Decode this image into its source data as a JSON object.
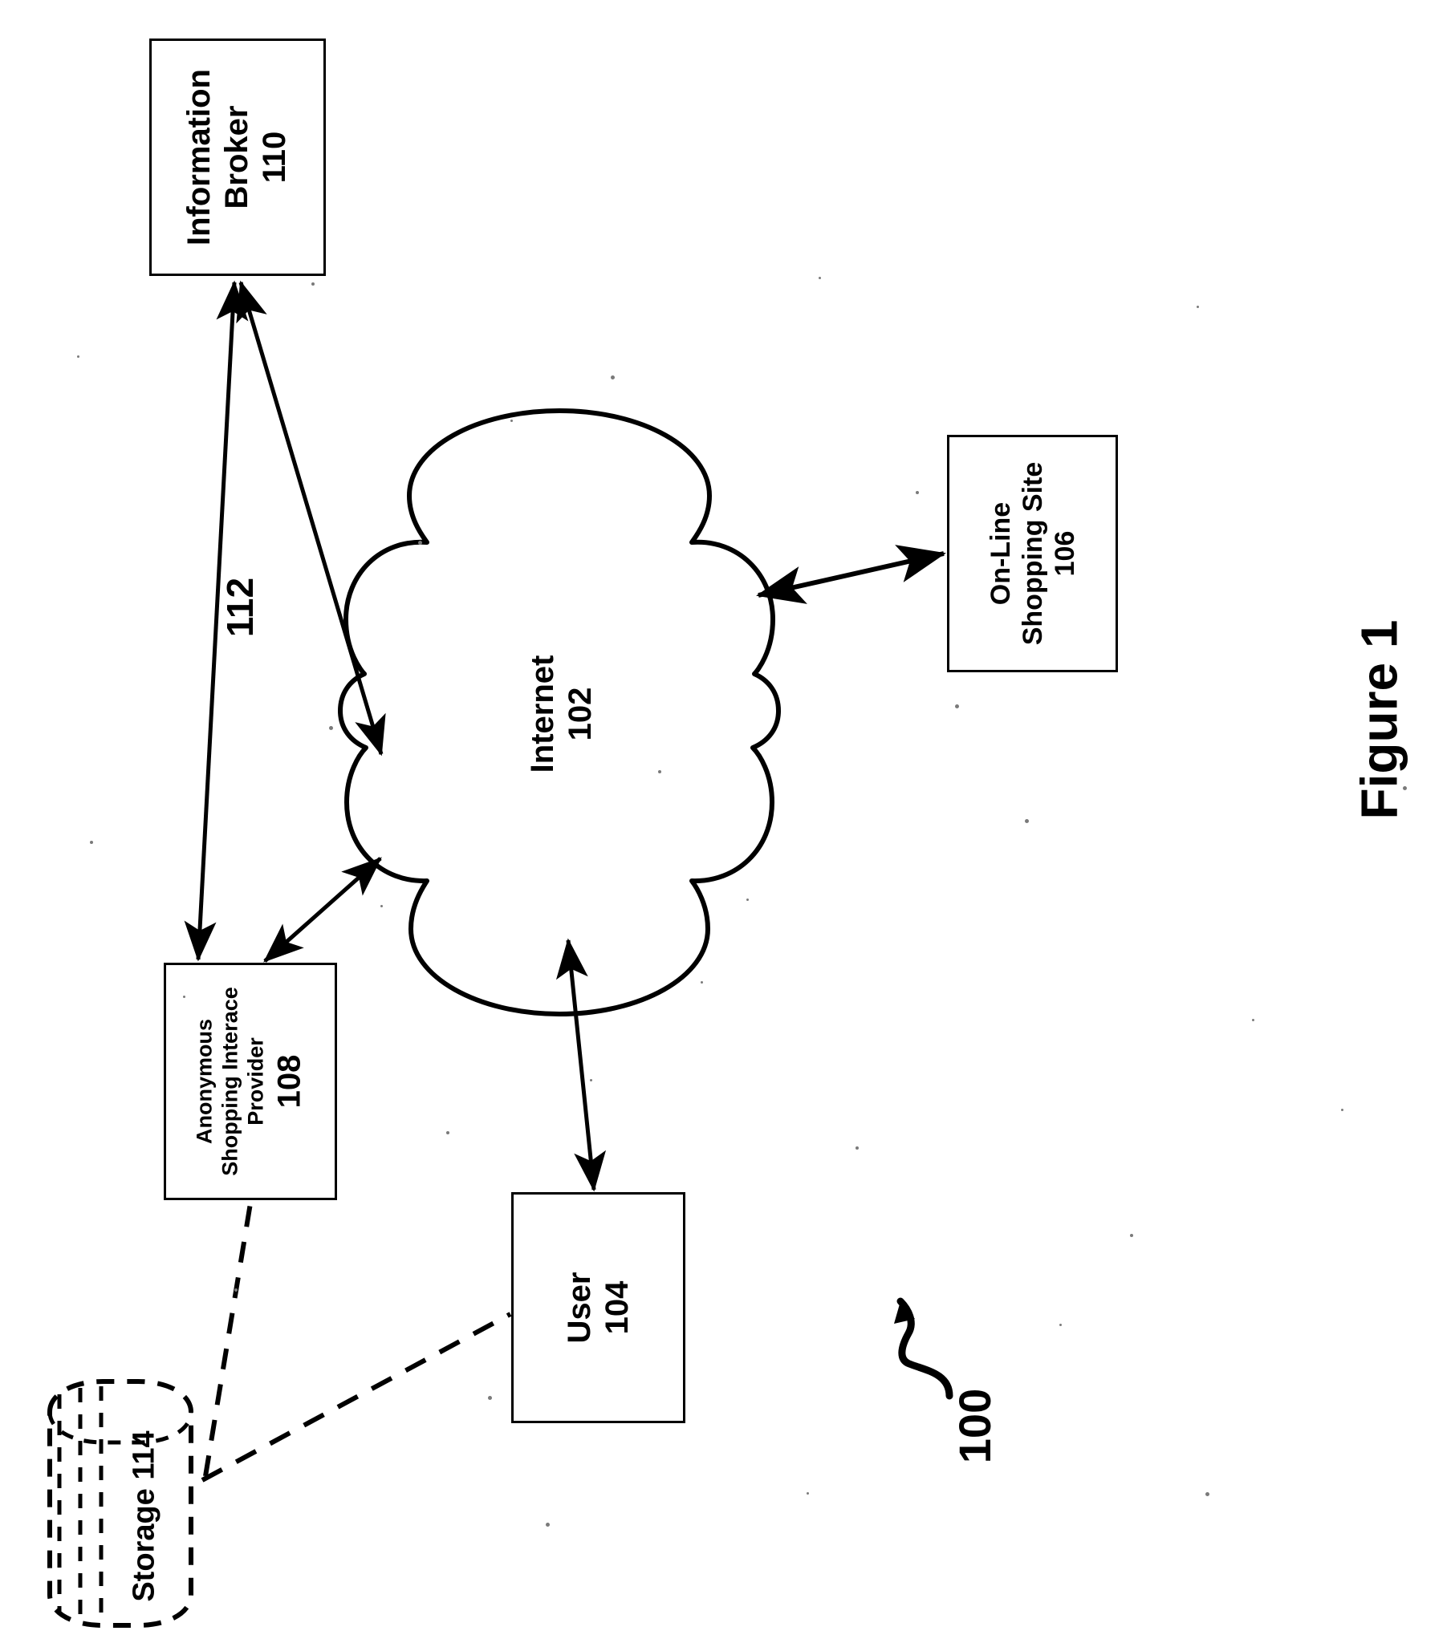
{
  "figure": {
    "caption": "Figure 1",
    "system_ref": "100"
  },
  "nodes": [
    {
      "id": "information-broker",
      "name": "Information Broker",
      "ref": "110",
      "lines": [
        "Information",
        "Broker",
        "110"
      ]
    },
    {
      "id": "internet",
      "name": "Internet",
      "ref": "102",
      "lines": [
        "Internet",
        "102"
      ]
    },
    {
      "id": "online-shopping-site",
      "name": "On-Line Shopping Site",
      "ref": "106",
      "lines": [
        "On-Line",
        "Shopping Site",
        "106"
      ]
    },
    {
      "id": "anonymous-shopping-interface-provider",
      "name": "Anonymous Shopping Interace Provider",
      "ref": "108",
      "lines": [
        "Anonymous",
        "Shopping Interace",
        "Provider",
        "108"
      ]
    },
    {
      "id": "user",
      "name": "User",
      "ref": "104",
      "lines": [
        "User",
        "104"
      ]
    },
    {
      "id": "storage",
      "name": "Storage 114",
      "ref": "114",
      "lines": [
        "Storage 114"
      ]
    }
  ],
  "connectors": [
    {
      "id": "broker-to-provider",
      "from": "information-broker",
      "to": "anonymous-shopping-interface-provider",
      "style": "solid",
      "arrow": "both",
      "label": "112"
    },
    {
      "id": "broker-to-internet",
      "from": "information-broker",
      "to": "internet",
      "style": "solid",
      "arrow": "both",
      "label": ""
    },
    {
      "id": "provider-to-internet",
      "from": "anonymous-shopping-interface-provider",
      "to": "internet",
      "style": "solid",
      "arrow": "both",
      "label": ""
    },
    {
      "id": "internet-to-shopping-site",
      "from": "internet",
      "to": "online-shopping-site",
      "style": "solid",
      "arrow": "both",
      "label": ""
    },
    {
      "id": "user-to-internet",
      "from": "user",
      "to": "internet",
      "style": "solid",
      "arrow": "both",
      "label": ""
    },
    {
      "id": "storage-to-provider",
      "from": "storage",
      "to": "anonymous-shopping-interface-provider",
      "style": "dashed",
      "arrow": "none",
      "label": ""
    },
    {
      "id": "storage-to-user",
      "from": "storage",
      "to": "user",
      "style": "dashed",
      "arrow": "none",
      "label": ""
    }
  ],
  "edge_labels": {
    "broker_provider": "112"
  }
}
